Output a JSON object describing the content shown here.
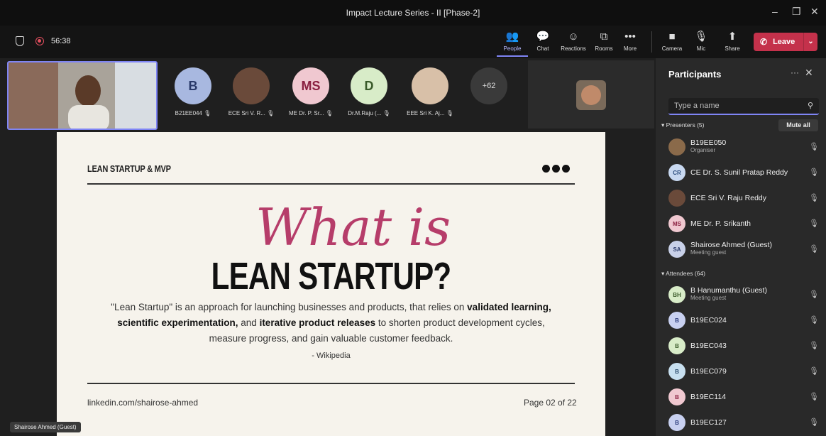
{
  "window": {
    "title": "Impact Lecture Series - II [Phase-2]",
    "controls": [
      "–",
      "❐",
      "✕"
    ]
  },
  "toolbar": {
    "timer": "56:38",
    "buttons": [
      {
        "label": "People",
        "icon": "people-icon",
        "glyph": "👥",
        "active": true
      },
      {
        "label": "Chat",
        "icon": "chat-icon",
        "glyph": "💬"
      },
      {
        "label": "Reactions",
        "icon": "reactions-icon",
        "glyph": "☺"
      },
      {
        "label": "Rooms",
        "icon": "rooms-icon",
        "glyph": "⧉"
      },
      {
        "label": "More",
        "icon": "more-icon",
        "glyph": "•••"
      },
      {
        "label": "Camera",
        "icon": "camera-off-icon",
        "glyph": "■"
      },
      {
        "label": "Mic",
        "icon": "mic-off-icon",
        "glyph": "🎙"
      },
      {
        "label": "Share",
        "icon": "share-icon",
        "glyph": "⬆"
      }
    ],
    "leave_label": "Leave",
    "leave_color": "#c4314b"
  },
  "strip": {
    "participants": [
      {
        "initials": "B",
        "name": "B21EE044",
        "bg": "#a8b8e0",
        "fg": "#2a3a6a"
      },
      {
        "initials": "",
        "name": "ECE Sri V. R...",
        "bg": "#6a4a3a",
        "fg": "#fff"
      },
      {
        "initials": "MS",
        "name": "ME Dr. P. Sr...",
        "bg": "#f0c8d0",
        "fg": "#8a2040"
      },
      {
        "initials": "D",
        "name": "Dr.M.Raju (...",
        "bg": "#d8ecc8",
        "fg": "#3a5a2a"
      },
      {
        "initials": "",
        "name": "EEE Sri K. Aj...",
        "bg": "#d8c0a8",
        "fg": "#fff"
      }
    ],
    "more_count": "+62",
    "self_name": "Shairose Ahmed (Guest)"
  },
  "slide": {
    "header": "LEAN STARTUP & MVP",
    "script_title": "What is",
    "big_title": "LEAN STARTUP?",
    "body_1": "\"Lean Startup\" is an approach for launching businesses and products, that relies on ",
    "body_b1": "validated learning, scientific experimentation,",
    "body_2": " and ",
    "body_b2": "iterative product releases",
    "body_3": " to shorten product development cycles, measure progress, and gain valuable customer feedback.",
    "source": "- Wikipedia",
    "footer_left": "linkedin.com/shairose-ahmed",
    "footer_right": "Page 02 of 22"
  },
  "panel": {
    "title": "Participants",
    "search_placeholder": "Type a name",
    "presenters_label": "Presenters (5)",
    "mute_all": "Mute all",
    "attendees_label": "Attendees (64)",
    "presenters": [
      {
        "initials": "",
        "name": "B19EE050",
        "sub": "Organiser",
        "bg": "#8a6a4a",
        "fg": "#fff",
        "mic": "mic-off-icon",
        "glyph": "🎙"
      },
      {
        "initials": "CR",
        "name": "CE Dr. S. Sunil Pratap Reddy",
        "sub": "",
        "bg": "#c8d8f0",
        "fg": "#2a4a7a",
        "mic": "mic-off-icon",
        "glyph": "🎙"
      },
      {
        "initials": "",
        "name": "ECE Sri V. Raju Reddy",
        "sub": "",
        "bg": "#6a4a3a",
        "fg": "#fff",
        "mic": "mic-off-icon",
        "glyph": "🎙"
      },
      {
        "initials": "MS",
        "name": "ME Dr. P. Srikanth",
        "sub": "",
        "bg": "#f0c8d0",
        "fg": "#8a2040",
        "mic": "mic-off-icon",
        "glyph": "🎙"
      },
      {
        "initials": "SA",
        "name": "Shairose Ahmed (Guest)",
        "sub": "Meeting guest",
        "bg": "#c8d0e8",
        "fg": "#2a3a6a",
        "mic": "mic-on-icon",
        "glyph": "🎙"
      }
    ],
    "attendees": [
      {
        "initials": "BH",
        "name": "B Hanumanthu (Guest)",
        "sub": "Meeting guest",
        "bg": "#d8ecc8",
        "fg": "#3a5a2a",
        "mic": "mic-off-icon",
        "glyph": "🎙"
      },
      {
        "initials": "B",
        "name": "B19EC024",
        "sub": "",
        "bg": "#c8d0f0",
        "fg": "#2a3a7a",
        "mic": "mic-off-icon",
        "glyph": "🎙"
      },
      {
        "initials": "B",
        "name": "B19EC043",
        "sub": "",
        "bg": "#d8ecc8",
        "fg": "#3a5a2a",
        "mic": "mic-off-icon",
        "glyph": "🎙"
      },
      {
        "initials": "B",
        "name": "B19EC079",
        "sub": "",
        "bg": "#c8e0f0",
        "fg": "#2a4a6a",
        "mic": "mic-off-icon",
        "glyph": "🎙"
      },
      {
        "initials": "B",
        "name": "B19EC114",
        "sub": "",
        "bg": "#f0c8d0",
        "fg": "#8a2040",
        "mic": "mic-off-icon",
        "glyph": "🎙"
      },
      {
        "initials": "B",
        "name": "B19EC127",
        "sub": "",
        "bg": "#c8d0f0",
        "fg": "#2a3a7a",
        "mic": "mic-off-icon",
        "glyph": "🎙"
      }
    ]
  }
}
